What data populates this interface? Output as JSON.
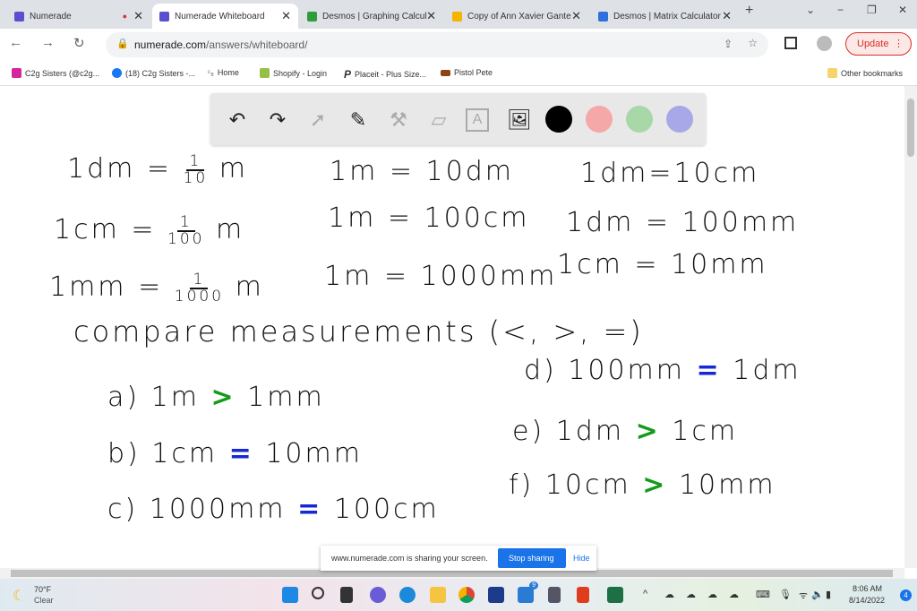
{
  "tabs": [
    {
      "label": "Numerade",
      "color": "#5a4fcf"
    },
    {
      "label": "Numerade Whiteboard",
      "color": "#5a4fcf",
      "active": true
    },
    {
      "label": "Desmos | Graphing Calcul",
      "color": "#2e9c3a"
    },
    {
      "label": "Copy of Ann Xavier Gante",
      "color": "#f4b400"
    },
    {
      "label": "Desmos | Matrix Calculator",
      "color": "#2f6fdc"
    }
  ],
  "address": {
    "domain": "numerade.com",
    "path": "/answers/whiteboard/"
  },
  "update_label": "Update",
  "bookmarks": [
    "C2g Sisters (@c2g...",
    "(18) C2g Sisters -...",
    "Home",
    "Shopify - Login",
    "Placeit - Plus Size...",
    "Pistol Pete"
  ],
  "other_bookmarks": "Other bookmarks",
  "whiteboard": {
    "colors": [
      "#000000",
      "#f4a8a8",
      "#a8d8a8",
      "#a8a8e8"
    ],
    "row1": [
      "1dm =",
      "1",
      "10",
      "m",
      "1m = 10dm",
      "1dm=10cm"
    ],
    "row2": [
      "1cm =",
      "1",
      "100",
      "m",
      "1m = 100cm",
      "1dm = 100mm"
    ],
    "row3": [
      "1mm =",
      "1",
      "1000",
      "m",
      "1m = 1000mm",
      "1cm = 10mm"
    ],
    "heading": "compare measurements (<, >, =)",
    "items": [
      {
        "left": "a) 1m",
        "op": ">",
        "right": "1mm"
      },
      {
        "left": "b) 1cm",
        "op": "=",
        "right": "10mm"
      },
      {
        "left": "c) 1000mm",
        "op": "=",
        "right": "100cm"
      },
      {
        "left": "d) 100mm",
        "op": "=",
        "right": "1dm"
      },
      {
        "left": "e) 1dm",
        "op": ">",
        "right": "1cm"
      },
      {
        "left": "f) 10cm",
        "op": ">",
        "right": "10mm"
      }
    ]
  },
  "share_bar": {
    "text": "www.numerade.com is sharing your screen.",
    "stop": "Stop sharing",
    "hide": "Hide"
  },
  "weather": {
    "temp": "70°F",
    "cond": "Clear"
  },
  "clock": {
    "time": "8:06 AM",
    "date": "8/14/2022"
  },
  "notif_count": "4",
  "mail_badge": "9"
}
